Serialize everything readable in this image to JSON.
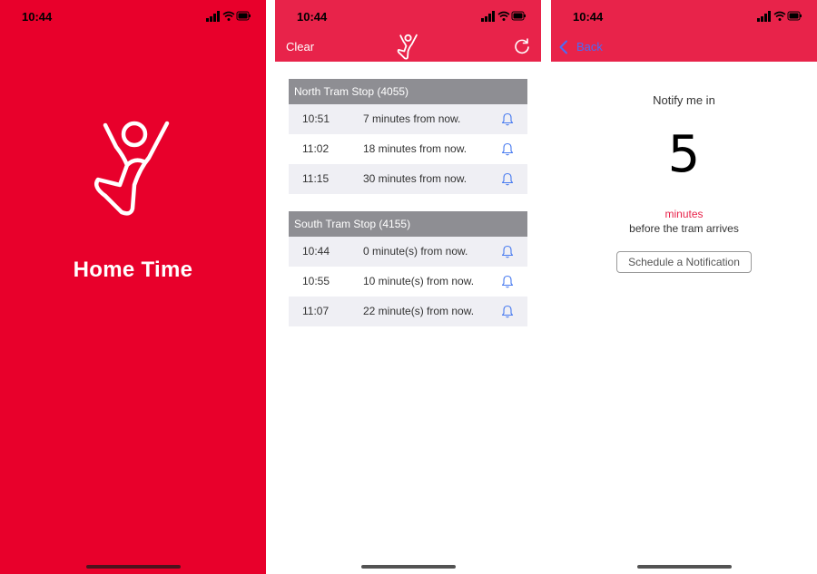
{
  "status_time": "10:44",
  "splash": {
    "title": "Home Time",
    "bg_color": "#e8002b"
  },
  "tram_list": {
    "nav": {
      "clear_label": "Clear",
      "logo_icon": "jumping-person-icon",
      "refresh_icon": "refresh-icon"
    },
    "sections": [
      {
        "header": "North Tram Stop (4055)",
        "rows": [
          {
            "time": "10:51",
            "msg": "7 minutes from now."
          },
          {
            "time": "11:02",
            "msg": "18 minutes from now."
          },
          {
            "time": "11:15",
            "msg": "30 minutes from now."
          }
        ]
      },
      {
        "header": "South Tram Stop (4155)",
        "rows": [
          {
            "time": "10:44",
            "msg": "0 minute(s) from now."
          },
          {
            "time": "10:55",
            "msg": "10 minute(s) from now."
          },
          {
            "time": "11:07",
            "msg": "22 minute(s) from now."
          }
        ]
      }
    ],
    "accent_color": "#e8234a",
    "bell_color": "#4a7cf0"
  },
  "notify": {
    "back_label": "Back",
    "notify_label": "Notify me in",
    "value": "5",
    "unit": "minutes",
    "suffix": "before the tram arrives",
    "button_label": "Schedule a Notification"
  }
}
